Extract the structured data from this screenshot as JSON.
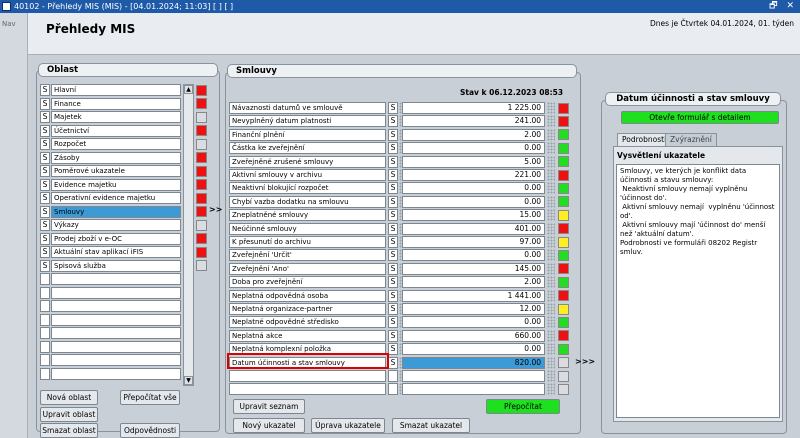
{
  "window": {
    "title": "40102 - Přehledy MIS (MIS) - [04.01.2024; 11:03] [ ] [ ]",
    "controls": "🗗 ✕"
  },
  "nav": {
    "label": "Nav"
  },
  "header": {
    "title": "Přehledy MIS",
    "date": "Dnes je Čtvrtek 04.01.2024, 01. týden"
  },
  "oblast": {
    "title": "Oblast",
    "items": [
      {
        "s": "S",
        "label": "Hlavní",
        "light": "red"
      },
      {
        "s": "S",
        "label": "Finance",
        "light": "red"
      },
      {
        "s": "S",
        "label": "Majetek",
        "light": "empty"
      },
      {
        "s": "S",
        "label": "Účetnictví",
        "light": "red"
      },
      {
        "s": "S",
        "label": "Rozpočet",
        "light": "empty"
      },
      {
        "s": "S",
        "label": "Zásoby",
        "light": "red"
      },
      {
        "s": "S",
        "label": "Poměrové ukazatele",
        "light": "red"
      },
      {
        "s": "S",
        "label": "Evidence majetku",
        "light": "red"
      },
      {
        "s": "S",
        "label": "Operativní evidence majetku",
        "light": "red"
      },
      {
        "s": "S",
        "label": "Smlouvy",
        "light": "red",
        "selected": true
      },
      {
        "s": "S",
        "label": "Výkazy",
        "light": "empty"
      },
      {
        "s": "S",
        "label": "Prodej zboží v e-OC",
        "light": "red"
      },
      {
        "s": "S",
        "label": "Aktuální stav aplikací iFIS",
        "light": "red"
      },
      {
        "s": "S",
        "label": "Spisová služba",
        "light": "empty"
      },
      {
        "s": "",
        "label": "",
        "light": "none"
      },
      {
        "s": "",
        "label": "",
        "light": "none"
      },
      {
        "s": "",
        "label": "",
        "light": "none"
      },
      {
        "s": "",
        "label": "",
        "light": "none"
      },
      {
        "s": "",
        "label": "",
        "light": "none"
      },
      {
        "s": "",
        "label": "",
        "light": "none"
      },
      {
        "s": "",
        "label": "",
        "light": "none"
      },
      {
        "s": "",
        "label": "",
        "light": "none"
      }
    ],
    "arrow": ">>",
    "buttons": {
      "new": "Nová oblast",
      "recalc_all": "Přepočítat vše",
      "edit": "Upravit oblast",
      "delete": "Smazat oblast",
      "responsibility": "Odpovědnosti"
    }
  },
  "smlouvy": {
    "title": "Smlouvy",
    "status_date": "Stav k 06.12.2023 08:53",
    "items": [
      {
        "label": "Návaznosti datumů ve smlouvě",
        "s": "S",
        "value": "1 225.00",
        "light": "red"
      },
      {
        "label": "Nevyplněný datum platnosti",
        "s": "S",
        "value": "241.00",
        "light": "red"
      },
      {
        "label": "Finanční plnění",
        "s": "S",
        "value": "2.00",
        "light": "green"
      },
      {
        "label": "Částka ke zveřejnění",
        "s": "S",
        "value": "0.00",
        "light": "green"
      },
      {
        "label": "Zveřejněné zrušené smlouvy",
        "s": "S",
        "value": "5.00",
        "light": "green"
      },
      {
        "label": "Aktivní smlouvy v archivu",
        "s": "S",
        "value": "221.00",
        "light": "red"
      },
      {
        "label": "Neaktivní blokující rozpočet",
        "s": "S",
        "value": "0.00",
        "light": "green"
      },
      {
        "label": "Chybí vazba dodatku na smlouvu",
        "s": "S",
        "value": "0.00",
        "light": "green"
      },
      {
        "label": "Zneplatněné smlouvy",
        "s": "S",
        "value": "15.00",
        "light": "yellow"
      },
      {
        "label": "Neúčinné smlouvy",
        "s": "S",
        "value": "401.00",
        "light": "red"
      },
      {
        "label": "K přesunutí do archivu",
        "s": "S",
        "value": "97.00",
        "light": "yellow"
      },
      {
        "label": "Zveřejnění 'Určit'",
        "s": "S",
        "value": "0.00",
        "light": "green"
      },
      {
        "label": "Zveřejnění 'Ano'",
        "s": "S",
        "value": "145.00",
        "light": "red"
      },
      {
        "label": "Doba pro zveřejnění",
        "s": "S",
        "value": "2.00",
        "light": "green"
      },
      {
        "label": "Neplatná odpovědná osoba",
        "s": "S",
        "value": "1 441.00",
        "light": "red"
      },
      {
        "label": "Neplatná organizace-partner",
        "s": "S",
        "value": "12.00",
        "light": "yellow"
      },
      {
        "label": "Neplatné odpovědné středisko",
        "s": "S",
        "value": "0.00",
        "light": "green"
      },
      {
        "label": "Neplatná akce",
        "s": "S",
        "value": "660.00",
        "light": "red"
      },
      {
        "label": "Neplatná komplexní položka",
        "s": "S",
        "value": "0.00",
        "light": "green"
      },
      {
        "label": "Datum účinnosti a stav smlouvy",
        "s": "S",
        "value": "820.00",
        "light": "empty",
        "selected": true
      },
      {
        "label": "",
        "s": "",
        "value": "",
        "light": "empty"
      },
      {
        "label": "",
        "s": "",
        "value": "",
        "light": "empty"
      }
    ],
    "arrow": ">>>",
    "buttons": {
      "edit_list": "Upravit seznam",
      "recalc": "Přepočítat",
      "new_indicator": "Nový ukazatel",
      "edit_indicator": "Úprava ukazatele",
      "delete_indicator": "Smazat ukazatel"
    }
  },
  "detail": {
    "title": "Datum účinnosti a stav smlouvy",
    "open_form": "Otevře formulář s detailem",
    "tabs": [
      "Podrobnosti",
      "Zvýraznění"
    ],
    "section_title": "Vysvětlení ukazatele",
    "explanation": [
      "Smlouvy, ve kterých je konflikt data",
      "účinnosti a stavu smlouvy:",
      " Neaktivní smlouvy nemají vyplněnu",
      "'účinnost do'.",
      " Aktivní smlouvy nemají  vyplněnu 'účinnost",
      "od'.",
      " Aktivní smlouvy mají 'účinnost do' menší",
      "než 'aktuální datum'.",
      "Podrobnosti ve formuláři 08202 Registr",
      "smluv."
    ]
  },
  "colors": {
    "red": "#ee1111",
    "green": "#22dd22",
    "yellow": "#ffee22",
    "selected": "#3c9ad6",
    "highlight_border": "#dd0000"
  }
}
